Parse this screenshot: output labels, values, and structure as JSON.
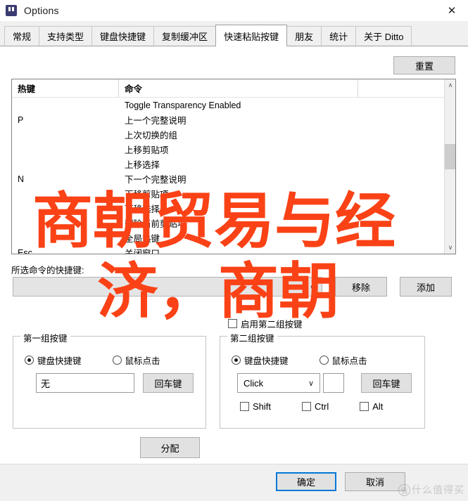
{
  "window": {
    "title": "Options",
    "icon": "ditto-quote-icon",
    "close_label": "✕"
  },
  "tabs": [
    {
      "label": "常规",
      "active": false
    },
    {
      "label": "支持类型",
      "active": false
    },
    {
      "label": "键盘快捷键",
      "active": false
    },
    {
      "label": "复制缓冲区",
      "active": false
    },
    {
      "label": "快速粘贴按键",
      "active": true
    },
    {
      "label": "朋友",
      "active": false
    },
    {
      "label": "统计",
      "active": false
    },
    {
      "label": "关于 Ditto",
      "active": false
    }
  ],
  "page": {
    "reset_button": "重置",
    "list": {
      "columns": [
        "热键",
        "命令"
      ],
      "rows": [
        {
          "hotkey": "",
          "command": "Toggle Transparency Enabled"
        },
        {
          "hotkey": "P",
          "command": "上一个完整说明"
        },
        {
          "hotkey": "",
          "command": "上次切换的组"
        },
        {
          "hotkey": "",
          "command": "上移剪贴项"
        },
        {
          "hotkey": "",
          "command": "上移选择"
        },
        {
          "hotkey": "N",
          "command": "下一个完整说明"
        },
        {
          "hotkey": "",
          "command": "下移剪贴项"
        },
        {
          "hotkey": "",
          "command": "下移选择"
        },
        {
          "hotkey": "",
          "command": "删除当前剪贴项"
        },
        {
          "hotkey": "",
          "command": "全局热键"
        },
        {
          "hotkey": "Esc",
          "command": "关闭窗口"
        }
      ],
      "scroll_up": "∧",
      "scroll_down": "∨"
    },
    "shortcut_label": "所选命令的快捷键:",
    "shortcut_value": "",
    "shortcut_chevron": "∨",
    "remove_button": "移除",
    "add_button": "添加",
    "enable_second_set": {
      "label": "启用第二组按键",
      "checked": false
    },
    "group1": {
      "title": "第一组按键",
      "radio_keyboard": "键盘快捷键",
      "radio_mouse": "鼠标点击",
      "selected": "keyboard",
      "key_value": "无",
      "enter_button": "回车键"
    },
    "group2": {
      "title": "第二组按键",
      "radio_keyboard": "键盘快捷键",
      "radio_mouse": "鼠标点击",
      "selected": "keyboard",
      "click_value": "Click",
      "click_chevron": "∨",
      "enter_button": "回车键",
      "modifiers": [
        {
          "label": "Shift",
          "checked": false
        },
        {
          "label": "Ctrl",
          "checked": false
        },
        {
          "label": "Alt",
          "checked": false
        }
      ]
    },
    "assign_button": "分配"
  },
  "footer": {
    "ok_button": "确定",
    "cancel_button": "取消"
  },
  "watermark": {
    "badge": "值",
    "text": "什么值得买"
  },
  "overlay": {
    "line1": "商朝贸易与经",
    "line2": "济，商朝",
    "color": "#FA4216"
  }
}
